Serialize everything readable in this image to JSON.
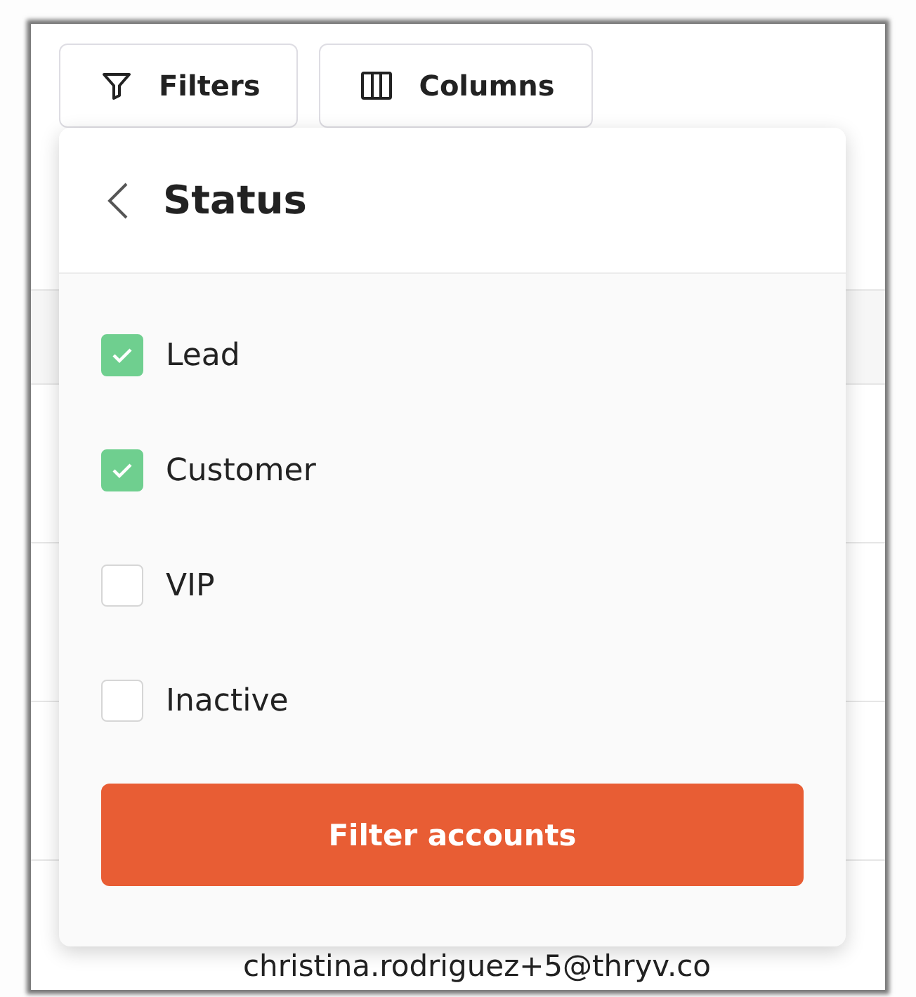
{
  "toolbar": [
    {
      "label": "Filters",
      "kind": "filter"
    },
    {
      "label": "Columns",
      "kind": "columns"
    }
  ],
  "filter_panel": {
    "title": "Status",
    "options": [
      {
        "label": "Lead",
        "checked": true
      },
      {
        "label": "Customer",
        "checked": true
      },
      {
        "label": "VIP",
        "checked": false
      },
      {
        "label": "Inactive",
        "checked": false
      }
    ],
    "action": "Filter accounts"
  },
  "table": {
    "rows": [
      {
        "email": "christina.rodriguez+5@thryv.co"
      }
    ]
  }
}
